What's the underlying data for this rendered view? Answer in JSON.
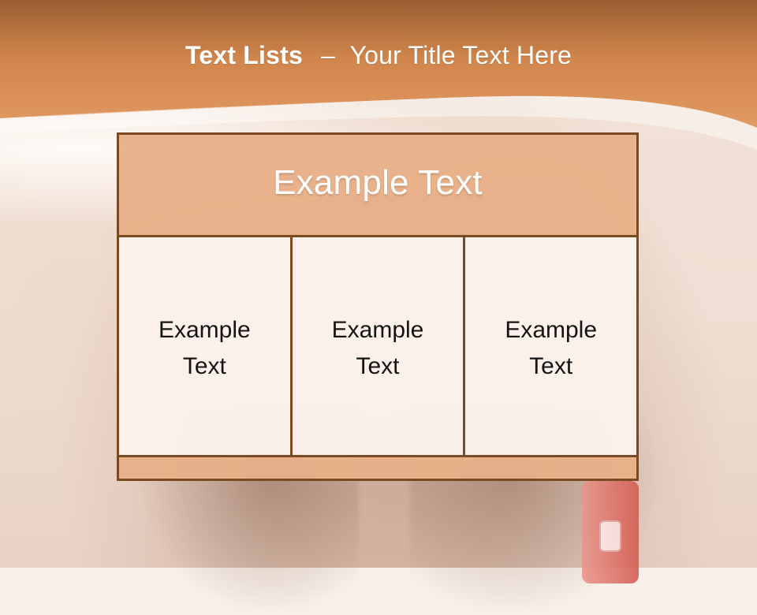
{
  "slide": {
    "title": {
      "bold": "Text Lists",
      "separator": "–",
      "rest": "Your Title Text Here"
    },
    "diagram": {
      "top_label": "Example Text",
      "columns": [
        {
          "label": "Example\nText"
        },
        {
          "label": "Example\nText"
        },
        {
          "label": "Example\nText"
        }
      ]
    }
  }
}
